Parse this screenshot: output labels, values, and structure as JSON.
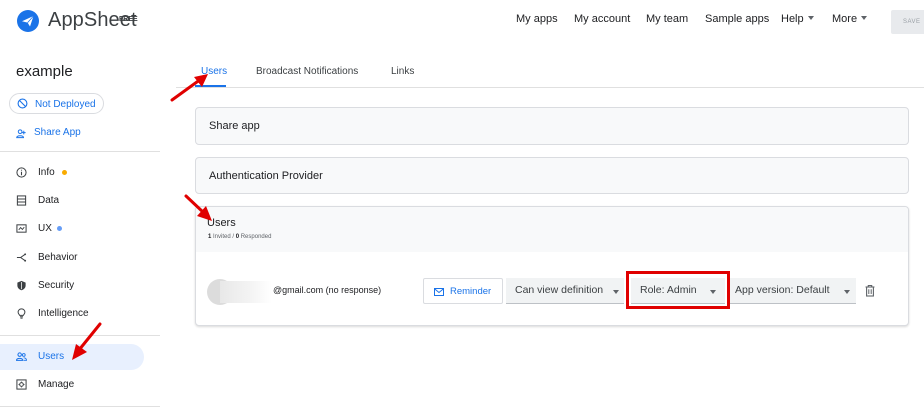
{
  "brand": {
    "name": "AppSheet",
    "tier": "FREE"
  },
  "topnav": {
    "my_apps": "My apps",
    "my_account": "My account",
    "my_team": "My team",
    "sample_apps": "Sample apps",
    "help": "Help",
    "more": "More",
    "save": "SAVE"
  },
  "sidebar": {
    "app_name": "example",
    "deploy_status": "Not Deployed",
    "share_app": "Share App",
    "items": [
      {
        "label": "Info",
        "icon": "info-icon",
        "dot_color": "#f9ab00"
      },
      {
        "label": "Data",
        "icon": "data-icon"
      },
      {
        "label": "UX",
        "icon": "ux-icon",
        "dot_color": "#669df6"
      },
      {
        "label": "Behavior",
        "icon": "behavior-icon"
      },
      {
        "label": "Security",
        "icon": "shield-icon"
      },
      {
        "label": "Intelligence",
        "icon": "lightbulb-icon"
      },
      {
        "label": "Users",
        "icon": "users-icon",
        "active": true
      },
      {
        "label": "Manage",
        "icon": "manage-icon"
      }
    ]
  },
  "tabs": [
    {
      "label": "Users",
      "active": true
    },
    {
      "label": "Broadcast Notifications"
    },
    {
      "label": "Links"
    }
  ],
  "panels": {
    "share_app": "Share app",
    "auth_provider": "Authentication Provider"
  },
  "users": {
    "title": "Users",
    "invited_count": "1",
    "invited_label": "Invited /",
    "responded_count": "0",
    "responded_label": "Responded",
    "rows": [
      {
        "email": "@gmail.com (no response)",
        "reminder_label": "Reminder",
        "permission": "Can view definition",
        "role": "Role: Admin",
        "app_version": "App version: Default"
      }
    ]
  },
  "colors": {
    "accent": "#1a73e8",
    "annotation_red": "#e00000",
    "active_bg": "#e8f0fe"
  }
}
